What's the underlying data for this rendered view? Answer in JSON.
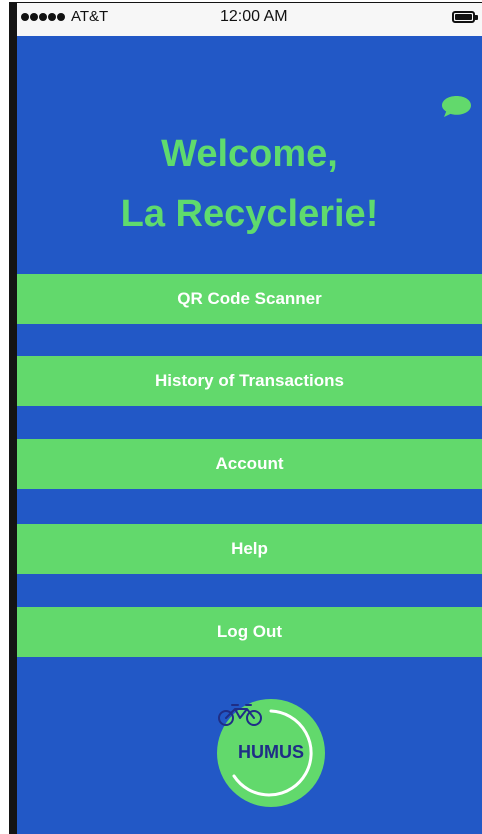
{
  "status_bar": {
    "carrier": "AT&T",
    "time": "12:00 AM",
    "signal_icon": "signal-dots-icon",
    "battery_icon": "battery-icon"
  },
  "header": {
    "welcome_line1": "Welcome,",
    "welcome_line2": "La Recyclerie!",
    "chat_icon": "chat-bubble-icon"
  },
  "menu": {
    "items": [
      {
        "label": "QR Code Scanner"
      },
      {
        "label": "History of Transactions"
      },
      {
        "label": "Account"
      },
      {
        "label": "Help"
      },
      {
        "label": "Log Out"
      }
    ]
  },
  "logo": {
    "text": "HUMUS",
    "icon": "bicycle-icon"
  },
  "colors": {
    "background": "#2258c6",
    "accent_green": "#62d96c",
    "heading_green": "#5fdb6d",
    "button_text": "#ffffff",
    "logo_text": "#1f2e86"
  }
}
